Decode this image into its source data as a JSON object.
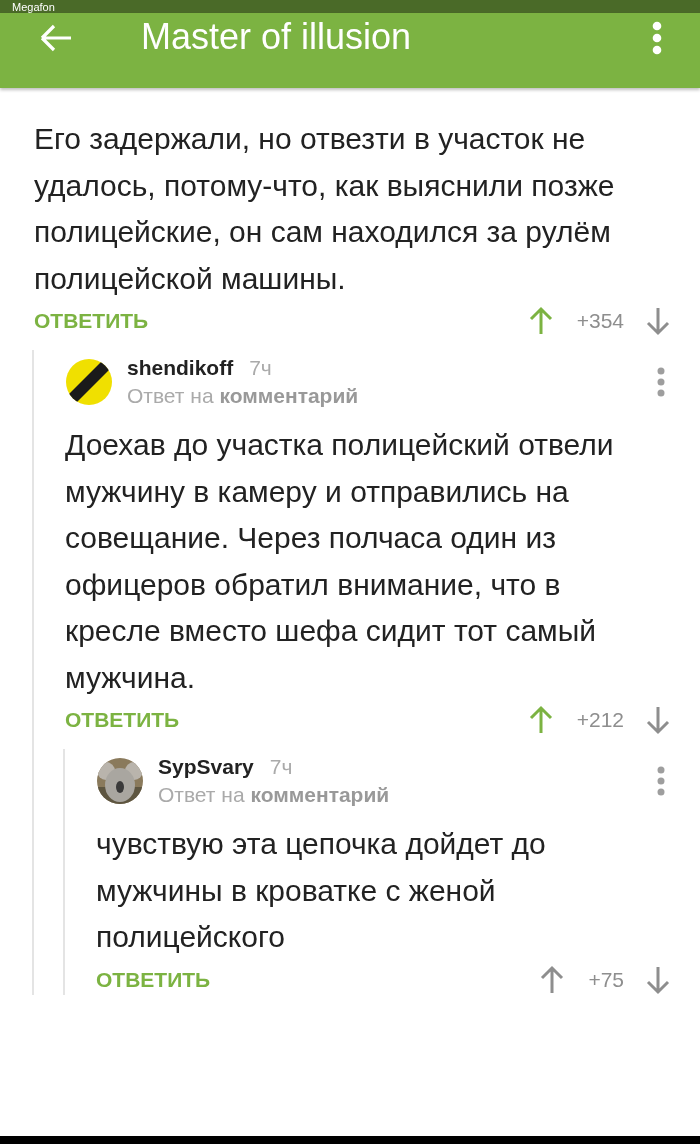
{
  "status_bar": {
    "carrier": "Megafon"
  },
  "app_bar": {
    "title": "Master of illusion"
  },
  "comment": {
    "text": "Его задержали, но отвезти в участок не удалось, потому-что, как выяснили позже полицейские, он сам находился за рулём полицейской машины.",
    "reply_label": "ОТВЕТИТЬ",
    "score": "+354",
    "upvoted": true,
    "children": [
      {
        "author": "shendikoff",
        "time": "7ч",
        "avatar": {
          "kind": "logo"
        },
        "reply_to": "Ответ на **комментарий**",
        "text": "Доехав до участка полицейский отвели мужчину в камеру и отправились на совещание. Через полчаса один из офицеров обратил внимание, что в кресле вместо шефа сидит тот самый мужчина.",
        "reply_label": "ОТВЕТИТЬ",
        "score": "+212",
        "upvoted": true,
        "children": [
          {
            "author": "SypSvary",
            "time": "7ч",
            "reply_to": "Ответ на **комментарий**",
            "text": "чувствую эта цепочка дойдет до мужчины в кроватке с женой полицейского",
            "reply_label": "ОТВЕТИТЬ",
            "score": "+75",
            "upvoted": false
          }
        ]
      }
    ]
  }
}
